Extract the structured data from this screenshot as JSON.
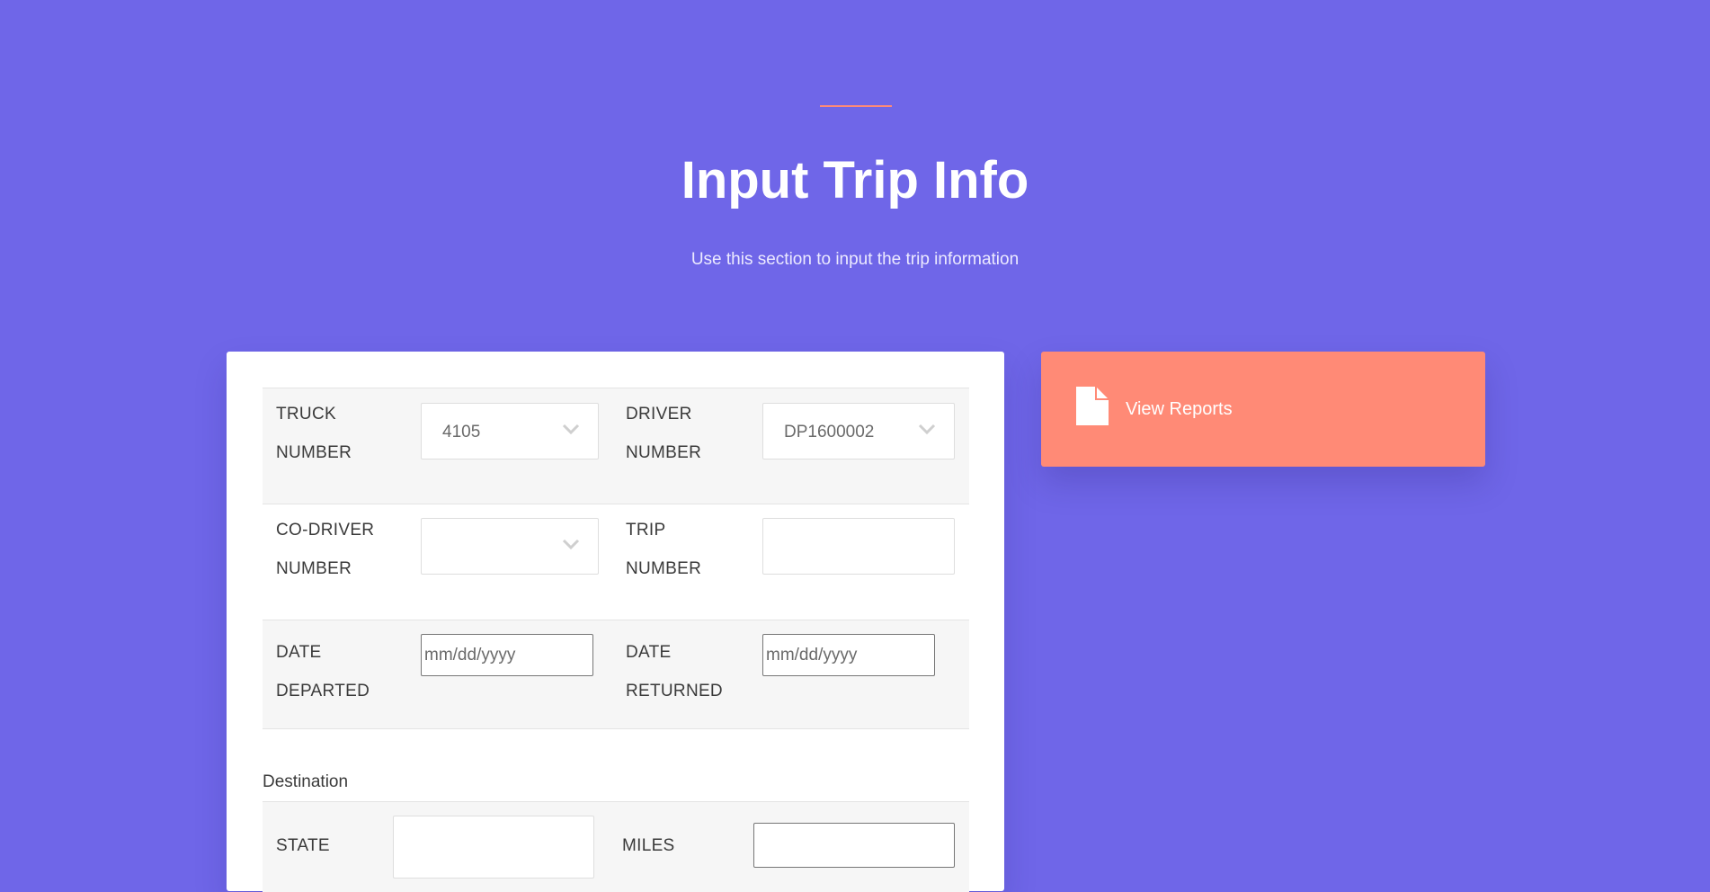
{
  "header": {
    "title": "Input Trip Info",
    "subtitle": "Use this section to input the trip information"
  },
  "form": {
    "truck_number": {
      "label_line1": "TRUCK",
      "label_line2": "NUMBER",
      "value": "4105"
    },
    "driver_number": {
      "label_line1": "DRIVER",
      "label_line2": "NUMBER",
      "value": "DP1600002"
    },
    "co_driver_number": {
      "label_line1": "CO-DRIVER",
      "label_line2": "NUMBER",
      "value": ""
    },
    "trip_number": {
      "label_line1": "TRIP",
      "label_line2": "NUMBER",
      "value": ""
    },
    "date_departed": {
      "label_line1": "DATE",
      "label_line2": "DEPARTED",
      "placeholder": "mm/dd/yyyy"
    },
    "date_returned": {
      "label_line1": "DATE",
      "label_line2": "RETURNED",
      "placeholder": "mm/dd/yyyy"
    }
  },
  "destination": {
    "heading": "Destination",
    "state_label": "STATE",
    "state_value": "",
    "miles_label": "MILES",
    "miles_value": ""
  },
  "reports_button": {
    "label": "View Reports",
    "icon": "document-icon"
  },
  "colors": {
    "background": "#6f66e8",
    "accent": "#ff8a76",
    "card": "#ffffff"
  }
}
